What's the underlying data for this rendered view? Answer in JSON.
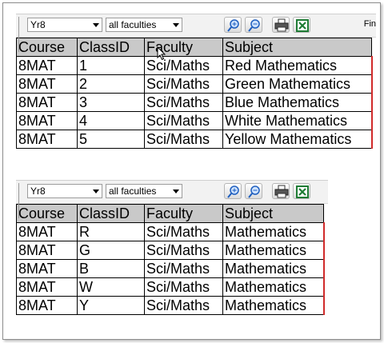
{
  "panel1": {
    "toolbar": {
      "year_select": "Yr8",
      "faculty_select": "all faculties",
      "find_label": "Fin",
      "buttons": [
        "zoom-in",
        "zoom-out",
        "print",
        "export-excel"
      ]
    },
    "table": {
      "headers": [
        "Course",
        "ClassID",
        "Faculty",
        "Subject"
      ],
      "rows": [
        [
          "8MAT",
          "1",
          "Sci/Maths",
          "Red Mathematics"
        ],
        [
          "8MAT",
          "2",
          "Sci/Maths",
          "Green Mathematics"
        ],
        [
          "8MAT",
          "3",
          "Sci/Maths",
          "Blue Mathematics"
        ],
        [
          "8MAT",
          "4",
          "Sci/Maths",
          "White Mathematics"
        ],
        [
          "8MAT",
          "5",
          "Sci/Maths",
          "Yellow Mathematics"
        ]
      ]
    }
  },
  "panel2": {
    "toolbar": {
      "year_select": "Yr8",
      "faculty_select": "all faculties",
      "buttons": [
        "zoom-in",
        "zoom-out",
        "print",
        "export-excel"
      ]
    },
    "table": {
      "headers": [
        "Course",
        "ClassID",
        "Faculty",
        "Subject"
      ],
      "rows": [
        [
          "8MAT",
          "R",
          "Sci/Maths",
          "Mathematics"
        ],
        [
          "8MAT",
          "G",
          "Sci/Maths",
          "Mathematics"
        ],
        [
          "8MAT",
          "B",
          "Sci/Maths",
          "Mathematics"
        ],
        [
          "8MAT",
          "W",
          "Sci/Maths",
          "Mathematics"
        ],
        [
          "8MAT",
          "Y",
          "Sci/Maths",
          "Mathematics"
        ]
      ]
    }
  },
  "colors": {
    "header_bg": "#c9c9c9",
    "row_edge_marker": "#d12b2b",
    "excel_icon": "#1e7b34"
  }
}
